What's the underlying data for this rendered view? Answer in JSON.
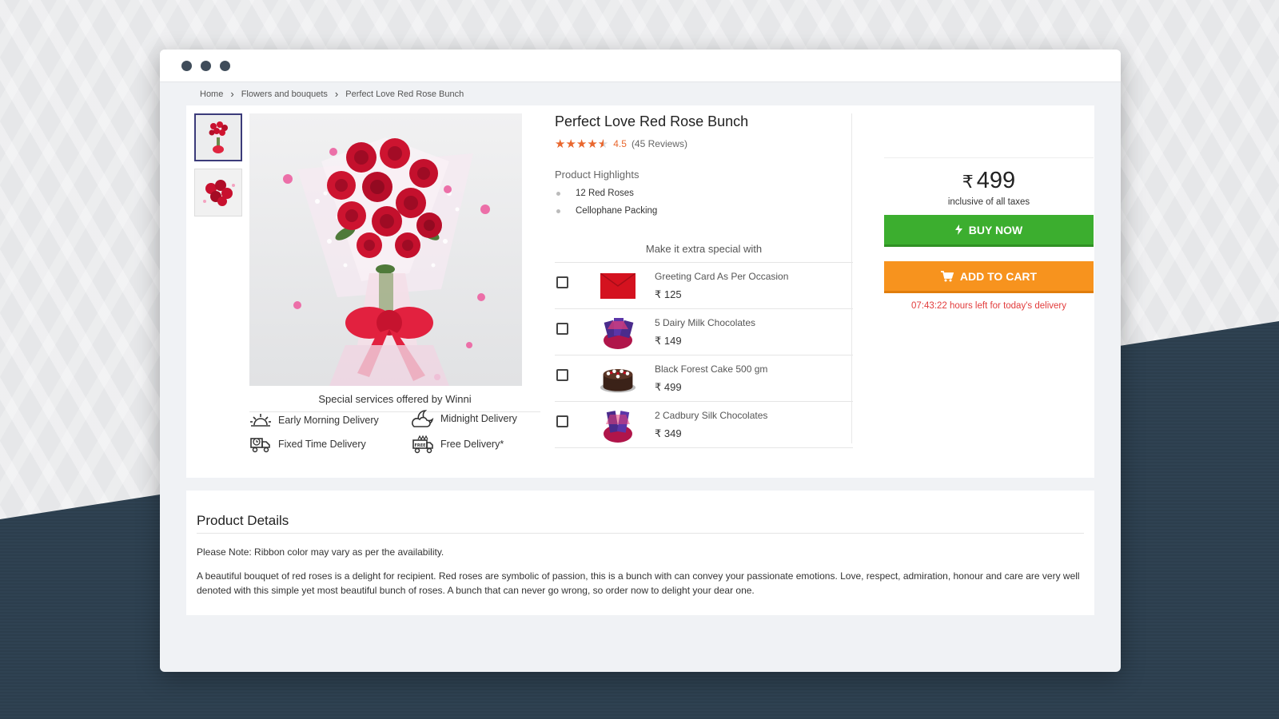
{
  "breadcrumb": {
    "home": "Home",
    "category": "Flowers and bouquets",
    "current": "Perfect Love Red Rose Bunch"
  },
  "product": {
    "title": "Perfect Love Red Rose Bunch",
    "rating": "4.5",
    "reviews": "(45 Reviews)",
    "stars_filled": 4.5,
    "highlights_title": "Product Highlights",
    "highlights": [
      "12 Red Roses",
      "Cellophane Packing"
    ]
  },
  "services": {
    "title": "Special services offered by Winni",
    "items": [
      "Early Morning Delivery",
      "Midnight Delivery",
      "Fixed Time Delivery",
      "Free Delivery*"
    ],
    "free_badge": "FREE"
  },
  "addons": {
    "title": "Make it extra special with",
    "items": [
      {
        "name": "Greeting Card As Per Occasion",
        "price": "₹ 125"
      },
      {
        "name": "5 Dairy Milk Chocolates",
        "price": "₹ 149"
      },
      {
        "name": "Black Forest Cake 500 gm",
        "price": "₹ 499"
      },
      {
        "name": "2 Cadbury Silk Chocolates",
        "price": "₹ 349"
      }
    ]
  },
  "purchase": {
    "currency": "₹",
    "price": "499",
    "tax_note": "inclusive of all taxes",
    "buy_now": "BUY NOW",
    "add_to_cart": "ADD TO CART",
    "timer": "07:43:22 hours left for today's delivery"
  },
  "details": {
    "title": "Product Details",
    "note": "Please Note: Ribbon color may vary as per the availability.",
    "description": "A beautiful bouquet of red roses is a delight for recipient. Red roses are symbolic of passion, this is a bunch with can convey your passionate emotions. Love, respect, admiration, honour and care are very well denoted with this simple yet most beautiful bunch of roses. A bunch that can never go wrong, so order now to delight your dear one."
  },
  "colors": {
    "buy_button": "#3cae2f",
    "cart_button": "#f7931e",
    "rating": "#e9672e",
    "timer": "#e23b3b"
  }
}
